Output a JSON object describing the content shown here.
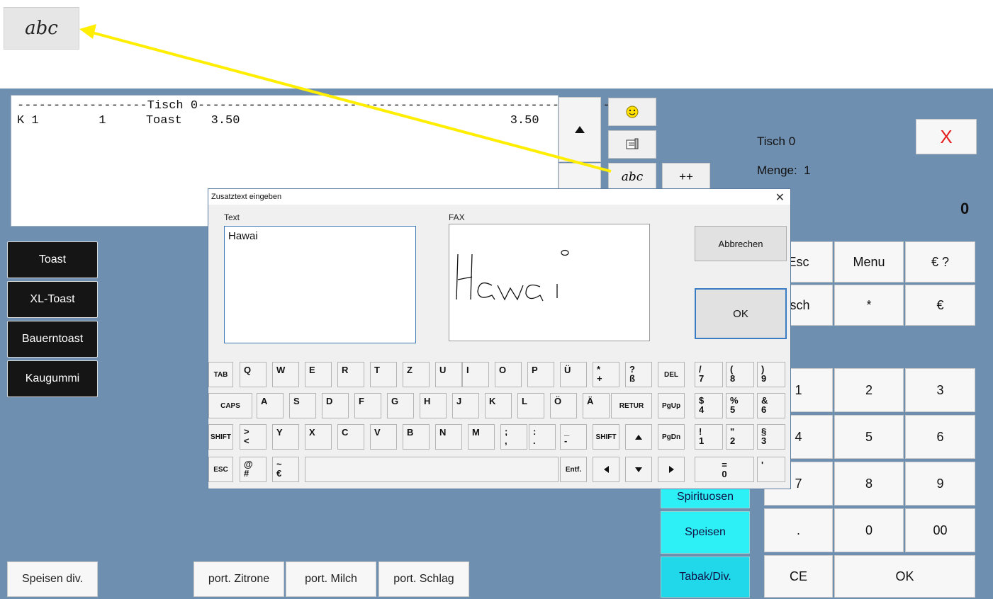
{
  "callout": {
    "label": "abc"
  },
  "receipt": {
    "header": "------------------Tisch 0-----------------------------------------------------------",
    "rows": [
      {
        "col1": "K 1",
        "col2": "  1",
        "col3": "Toast    3.50",
        "col4": "3.50"
      }
    ]
  },
  "icons": {
    "smile": "smiley-icon",
    "printer": "print-icon",
    "abc": "abc"
  },
  "plus_button": "++",
  "info": {
    "table": "Tisch 0",
    "quantity_label": "Menge:",
    "quantity_value": "1",
    "total": "0"
  },
  "close_x": "X",
  "products": [
    "Toast",
    "XL-Toast",
    "Bauerntoast",
    "Kaugummi"
  ],
  "keypad": {
    "row1": [
      "Esc",
      "Menu",
      "€ ?"
    ],
    "row2": [
      "isch",
      "*",
      "€"
    ],
    "row3": [
      "1",
      "2",
      "3"
    ],
    "row4": [
      "4",
      "5",
      "6"
    ],
    "row5": [
      "7",
      "8",
      "9"
    ],
    "row6": [
      ".",
      "0",
      "00"
    ],
    "row7": [
      "CE",
      "OK"
    ]
  },
  "categories": [
    "Spirituosen",
    "Speisen",
    "Tabak/Div."
  ],
  "bottom_buttons": [
    "Speisen div.",
    "port. Zitrone",
    "port. Milch",
    "port. Schlag"
  ],
  "dialog": {
    "title": "Zusatztext eingeben",
    "text_label": "Text",
    "text_value": "Hawai",
    "fax_label": "FAX",
    "cancel": "Abbrechen",
    "ok": "OK",
    "keys": {
      "tab": "TAB",
      "caps": "CAPS",
      "shift": "SHIFT",
      "esc": "ESC",
      "del": "DEL",
      "retur": "RETUR",
      "pgup": "PgUp",
      "pgdn": "PgDn",
      "entf": "Entf.",
      "row1": [
        "Q",
        "W",
        "E",
        "R",
        "T",
        "Z",
        "U",
        "I",
        "O",
        "P",
        "Ü"
      ],
      "row2": [
        "A",
        "S",
        "D",
        "F",
        "G",
        "H",
        "J",
        "K",
        "L",
        "Ö",
        "Ä"
      ],
      "row3": [
        "Y",
        "X",
        "C",
        "V",
        "B",
        "N",
        "M"
      ],
      "plus_top": "*",
      "plus_bot": "+",
      "sz_top": "?",
      "sz_bot": "ß",
      "lt_top": ">",
      "lt_bot": "<",
      "semi_top": ";",
      "semi_bot": ",",
      "colon_top": ":",
      "colon_bot": ".",
      "under_top": "_",
      "under_bot": "-",
      "at_top": "@",
      "at_bot": "#",
      "tilde_top": "~",
      "tilde_bot": "€",
      "n7_top": "/",
      "n7_bot": "7",
      "n8_top": "(",
      "n8_bot": "8",
      "n9_top": ")",
      "n9_bot": "9",
      "n4_top": "$",
      "n4_bot": "4",
      "n5_top": "%",
      "n5_bot": "5",
      "n6_top": "&",
      "n6_bot": "6",
      "n1_top": "!",
      "n1_bot": "1",
      "n2_top": "\"",
      "n2_bot": "2",
      "n3_top": "§",
      "n3_bot": "3",
      "n0_top": "=",
      "n0_bot": "0",
      "apos": "'"
    }
  }
}
